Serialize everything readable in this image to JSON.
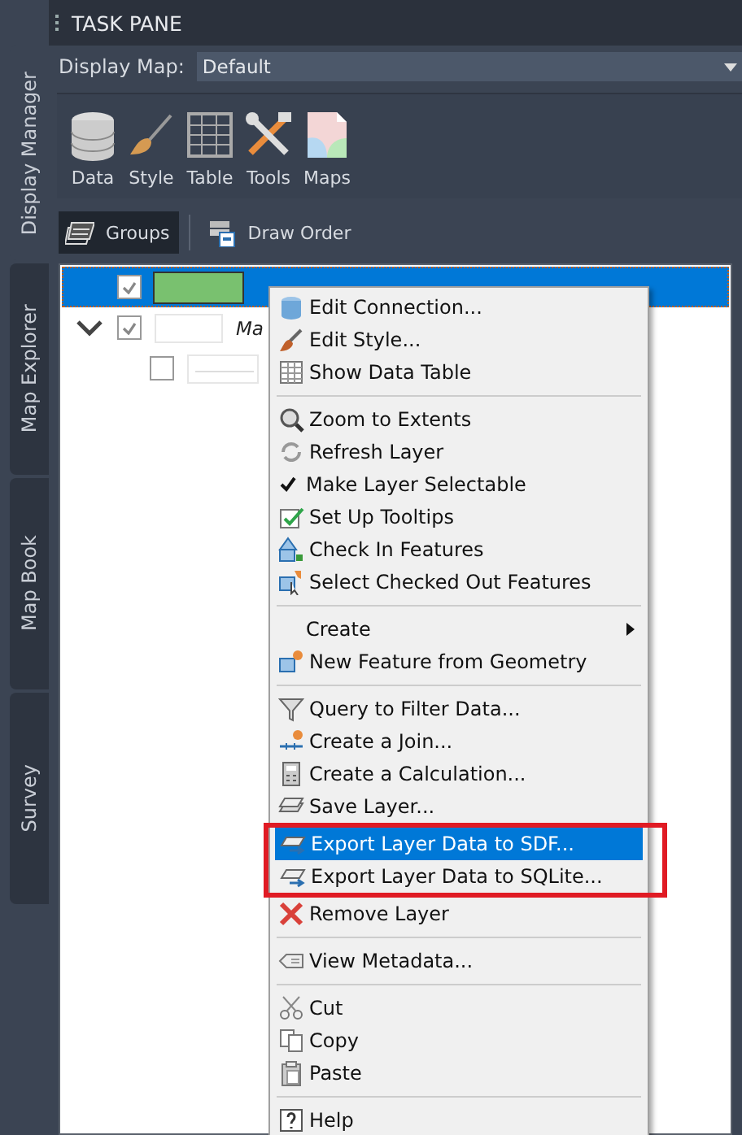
{
  "side_tabs": [
    {
      "label": "Display Manager",
      "selected": true
    },
    {
      "label": "Map Explorer",
      "selected": false
    },
    {
      "label": "Map Book",
      "selected": false
    },
    {
      "label": "Survey",
      "selected": false
    }
  ],
  "window": {
    "title": "TASK PANE"
  },
  "display_map": {
    "label": "Display Map:",
    "value": "Default"
  },
  "toolbar": [
    "Data",
    "Style",
    "Table",
    "Tools",
    "Maps"
  ],
  "view_tabs": [
    {
      "label": "Groups",
      "selected": true
    },
    {
      "label": "Draw Order",
      "selected": false
    }
  ],
  "layers": [
    {
      "checked": true,
      "selected": true,
      "color": "#79c16f"
    },
    {
      "name": "Ma",
      "checked": true,
      "selected": false,
      "expanded": true,
      "color": "#ffffff",
      "children": [
        {
          "checked": false,
          "selected": false,
          "color": "#ffffff"
        }
      ]
    }
  ],
  "context_menu": [
    {
      "kind": "item",
      "label": "Edit Connection..."
    },
    {
      "kind": "item",
      "label": "Edit Style..."
    },
    {
      "kind": "item",
      "label": "Show Data Table"
    },
    {
      "kind": "separator"
    },
    {
      "kind": "item",
      "label": "Zoom to Extents"
    },
    {
      "kind": "item",
      "label": "Refresh Layer"
    },
    {
      "kind": "check",
      "label": "Make Layer Selectable",
      "checked": true
    },
    {
      "kind": "item",
      "label": "Set Up Tooltips"
    },
    {
      "kind": "item",
      "label": "Check In Features"
    },
    {
      "kind": "item",
      "label": "Select Checked Out Features"
    },
    {
      "kind": "separator"
    },
    {
      "kind": "submenu",
      "label": "Create"
    },
    {
      "kind": "item",
      "label": "New Feature from Geometry"
    },
    {
      "kind": "separator"
    },
    {
      "kind": "item",
      "label": "Query to Filter Data..."
    },
    {
      "kind": "item",
      "label": "Create a Join..."
    },
    {
      "kind": "item",
      "label": "Create a Calculation..."
    },
    {
      "kind": "item",
      "label": "Save Layer..."
    },
    {
      "kind": "item",
      "label": "Export Layer Data to SDF...",
      "selected": true,
      "framed": true
    },
    {
      "kind": "item",
      "label": "Export Layer Data to SQLite...",
      "framed": true
    },
    {
      "kind": "item",
      "label": "Remove Layer"
    },
    {
      "kind": "separator"
    },
    {
      "kind": "item",
      "label": "View Metadata..."
    },
    {
      "kind": "separator"
    },
    {
      "kind": "item",
      "label": "Cut"
    },
    {
      "kind": "item",
      "label": "Copy"
    },
    {
      "kind": "item",
      "label": "Paste"
    },
    {
      "kind": "separator"
    },
    {
      "kind": "item",
      "label": "Help"
    }
  ]
}
